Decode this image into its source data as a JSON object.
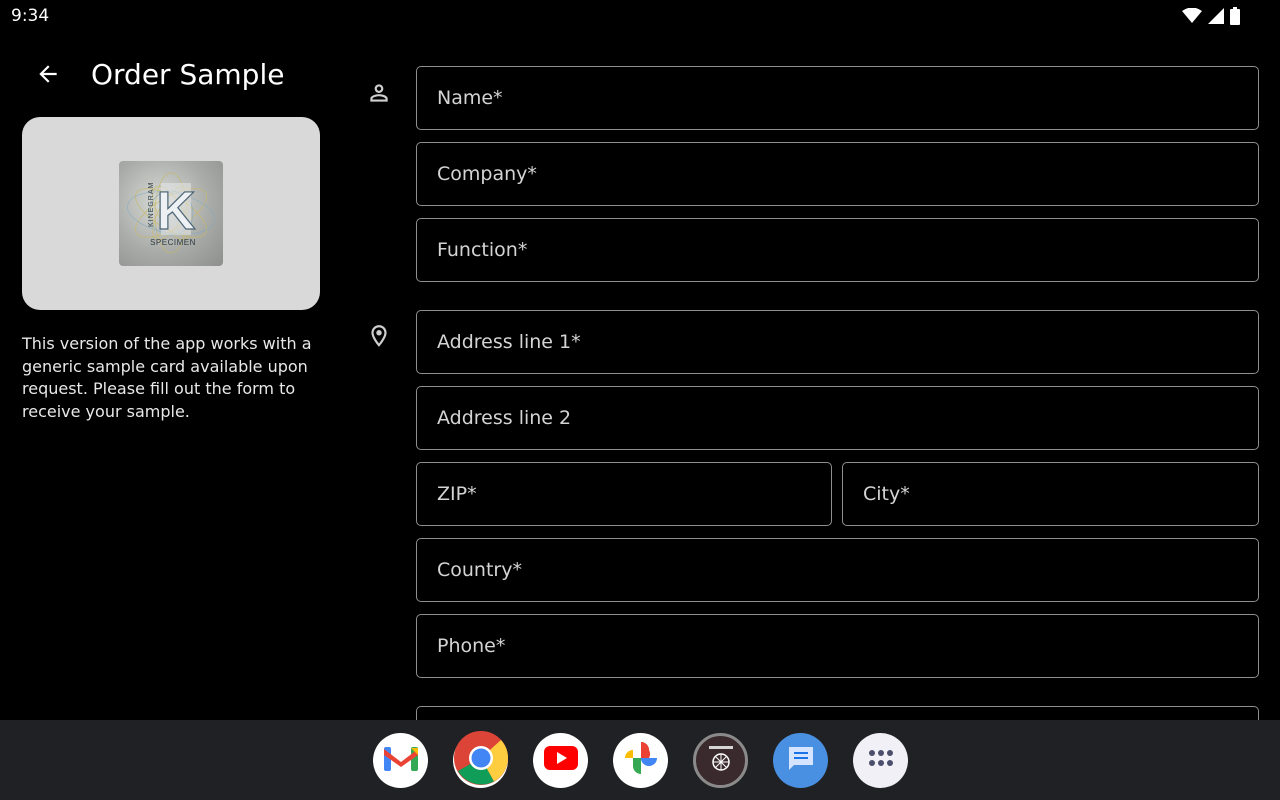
{
  "status_bar": {
    "time": "9:34",
    "icons": [
      "wifi-icon",
      "cell-signal-icon",
      "battery-icon"
    ]
  },
  "header": {
    "back_icon": "arrow-left-icon",
    "title": "Order Sample"
  },
  "sample_card": {
    "image": "kinegram-specimen-hologram",
    "letter": "K",
    "side_text": "KINEGRAM",
    "bottom_text": "SPECIMEN"
  },
  "description": "This version of the app works with a generic sample card available upon request. Please fill out the form to receive your sample.",
  "form": {
    "person_section_icon": "person-icon",
    "address_section_icon": "location-pin-icon",
    "fields": {
      "name": {
        "value": "",
        "placeholder": "Name*"
      },
      "company": {
        "value": "",
        "placeholder": "Company*"
      },
      "function": {
        "value": "",
        "placeholder": "Function*"
      },
      "address1": {
        "value": "",
        "placeholder": "Address line 1*"
      },
      "address2": {
        "value": "",
        "placeholder": "Address line 2"
      },
      "zip": {
        "value": "",
        "placeholder": "ZIP*"
      },
      "city": {
        "value": "",
        "placeholder": "City*"
      },
      "country": {
        "value": "",
        "placeholder": "Country*"
      },
      "phone": {
        "value": "",
        "placeholder": "Phone*"
      }
    }
  },
  "dock": {
    "apps": [
      "gmail-icon",
      "chrome-icon",
      "youtube-icon",
      "photos-icon",
      "kinegram-app-icon",
      "messages-icon",
      "app-drawer-icon"
    ]
  },
  "colors": {
    "background": "#000000",
    "field_border": "#8e8e8e",
    "dock_background": "#202124",
    "card_background": "#d9d9d9"
  }
}
